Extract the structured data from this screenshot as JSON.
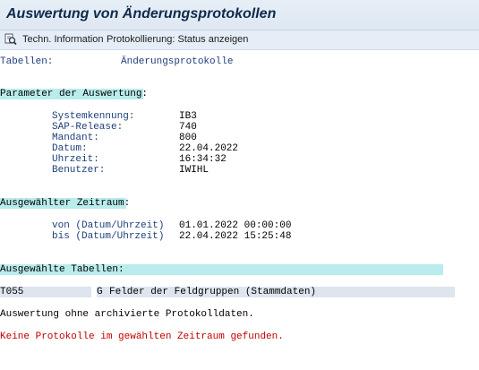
{
  "window": {
    "title": "Auswertung von Änderungsprotokollen"
  },
  "toolbar": {
    "tech_info_icon": "magnifier-document-icon",
    "tech_info_label": "Techn. Information",
    "status_label": "Protokollierung: Status anzeigen"
  },
  "header": {
    "label": "Tabellen:",
    "value": "Änderungsprotokolle"
  },
  "params": {
    "heading": "Parameter der Auswertung:",
    "rows": [
      {
        "label": "Systemkennung:",
        "value": "IB3"
      },
      {
        "label": "SAP-Release:",
        "value": "740"
      },
      {
        "label": "Mandant:",
        "value": "800"
      },
      {
        "label": "Datum:",
        "value": "22.04.2022"
      },
      {
        "label": "Uhrzeit:",
        "value": "16:34:32"
      },
      {
        "label": "Benutzer:",
        "value": "IWIHL"
      }
    ]
  },
  "period": {
    "heading": "Ausgewählter Zeitraum:",
    "from_label": "von (Datum/Uhrzeit)",
    "from_value": "01.01.2022 00:00:00",
    "to_label": "bis (Datum/Uhrzeit)",
    "to_value": "22.04.2022 15:25:48"
  },
  "tables": {
    "heading": "Ausgewählte Tabellen:",
    "rows": [
      {
        "name": "T055",
        "flag": "G",
        "description": "Felder der Feldgruppen (Stammdaten)"
      }
    ]
  },
  "messages": {
    "info": "Auswertung ohne archivierte Protokolldaten.",
    "error": "Keine Protokolle im gewählten Zeitraum gefunden."
  },
  "colors": {
    "section_highlight": "#b9ecec",
    "text_blue": "#1f3f7a",
    "error_red": "#c00000"
  }
}
